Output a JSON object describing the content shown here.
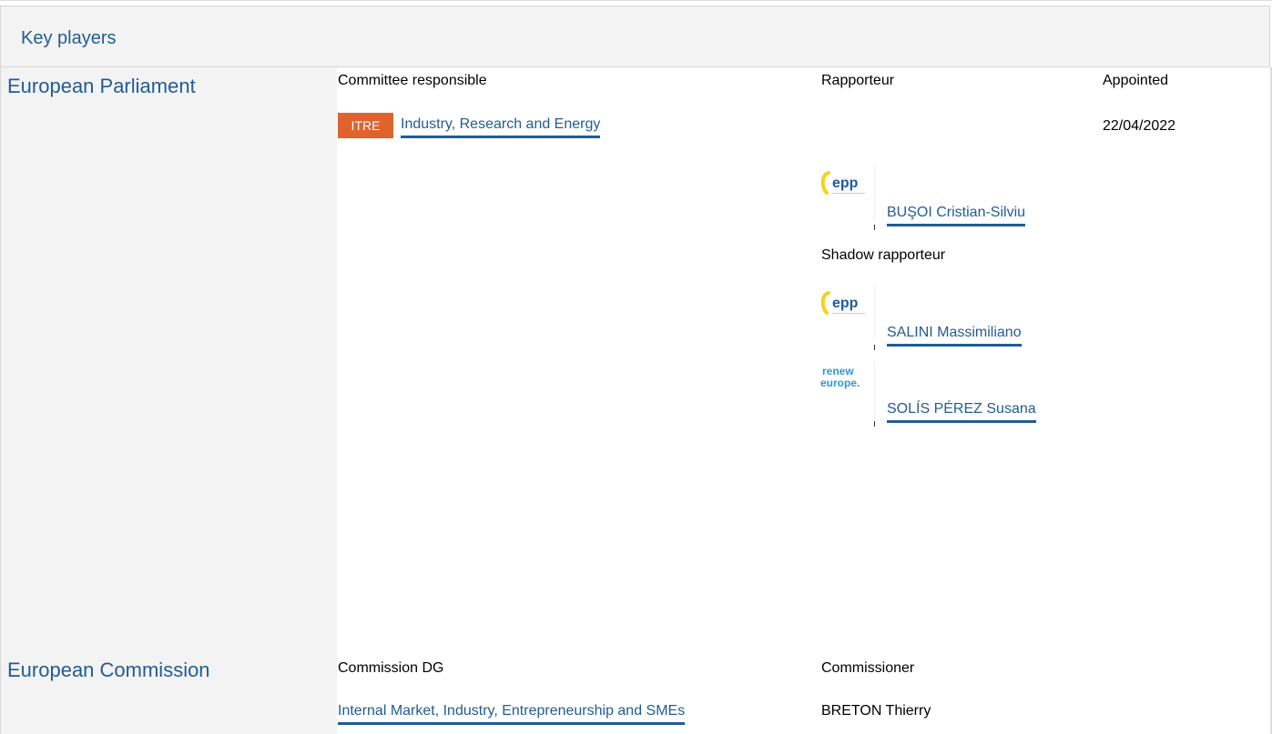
{
  "header": {
    "title": "Key players"
  },
  "parliament": {
    "title": "European Parliament",
    "col_committee": "Committee responsible",
    "col_rapporteur": "Rapporteur",
    "col_appointed": "Appointed",
    "committee_code": "ITRE",
    "committee_name": "Industry, Research and Energy",
    "appointed_date": "22/04/2022",
    "rapporteur": {
      "name": "BUŞOI Cristian-Silviu",
      "group_logo": "epp-logo"
    },
    "shadow_label": "Shadow rapporteur",
    "shadows": [
      {
        "name": "SALINI Massimiliano",
        "group_logo": "epp-logo"
      },
      {
        "name": "SOLÍS PÉREZ Susana",
        "group_logo": "renew-europe-logo"
      }
    ],
    "logo_text": {
      "epp": "epp",
      "renew_line1": "renew",
      "renew_line2": "europe."
    }
  },
  "commission": {
    "title": "European Commission",
    "col_dg": "Commission DG",
    "col_commissioner": "Commissioner",
    "dg_name": "Internal Market, Industry, Entrepreneurship and SMEs",
    "commissioner": "BRETON Thierry"
  },
  "colors": {
    "link": "#225c92",
    "badge": "#e0622c",
    "panel": "#f3f3f3"
  }
}
